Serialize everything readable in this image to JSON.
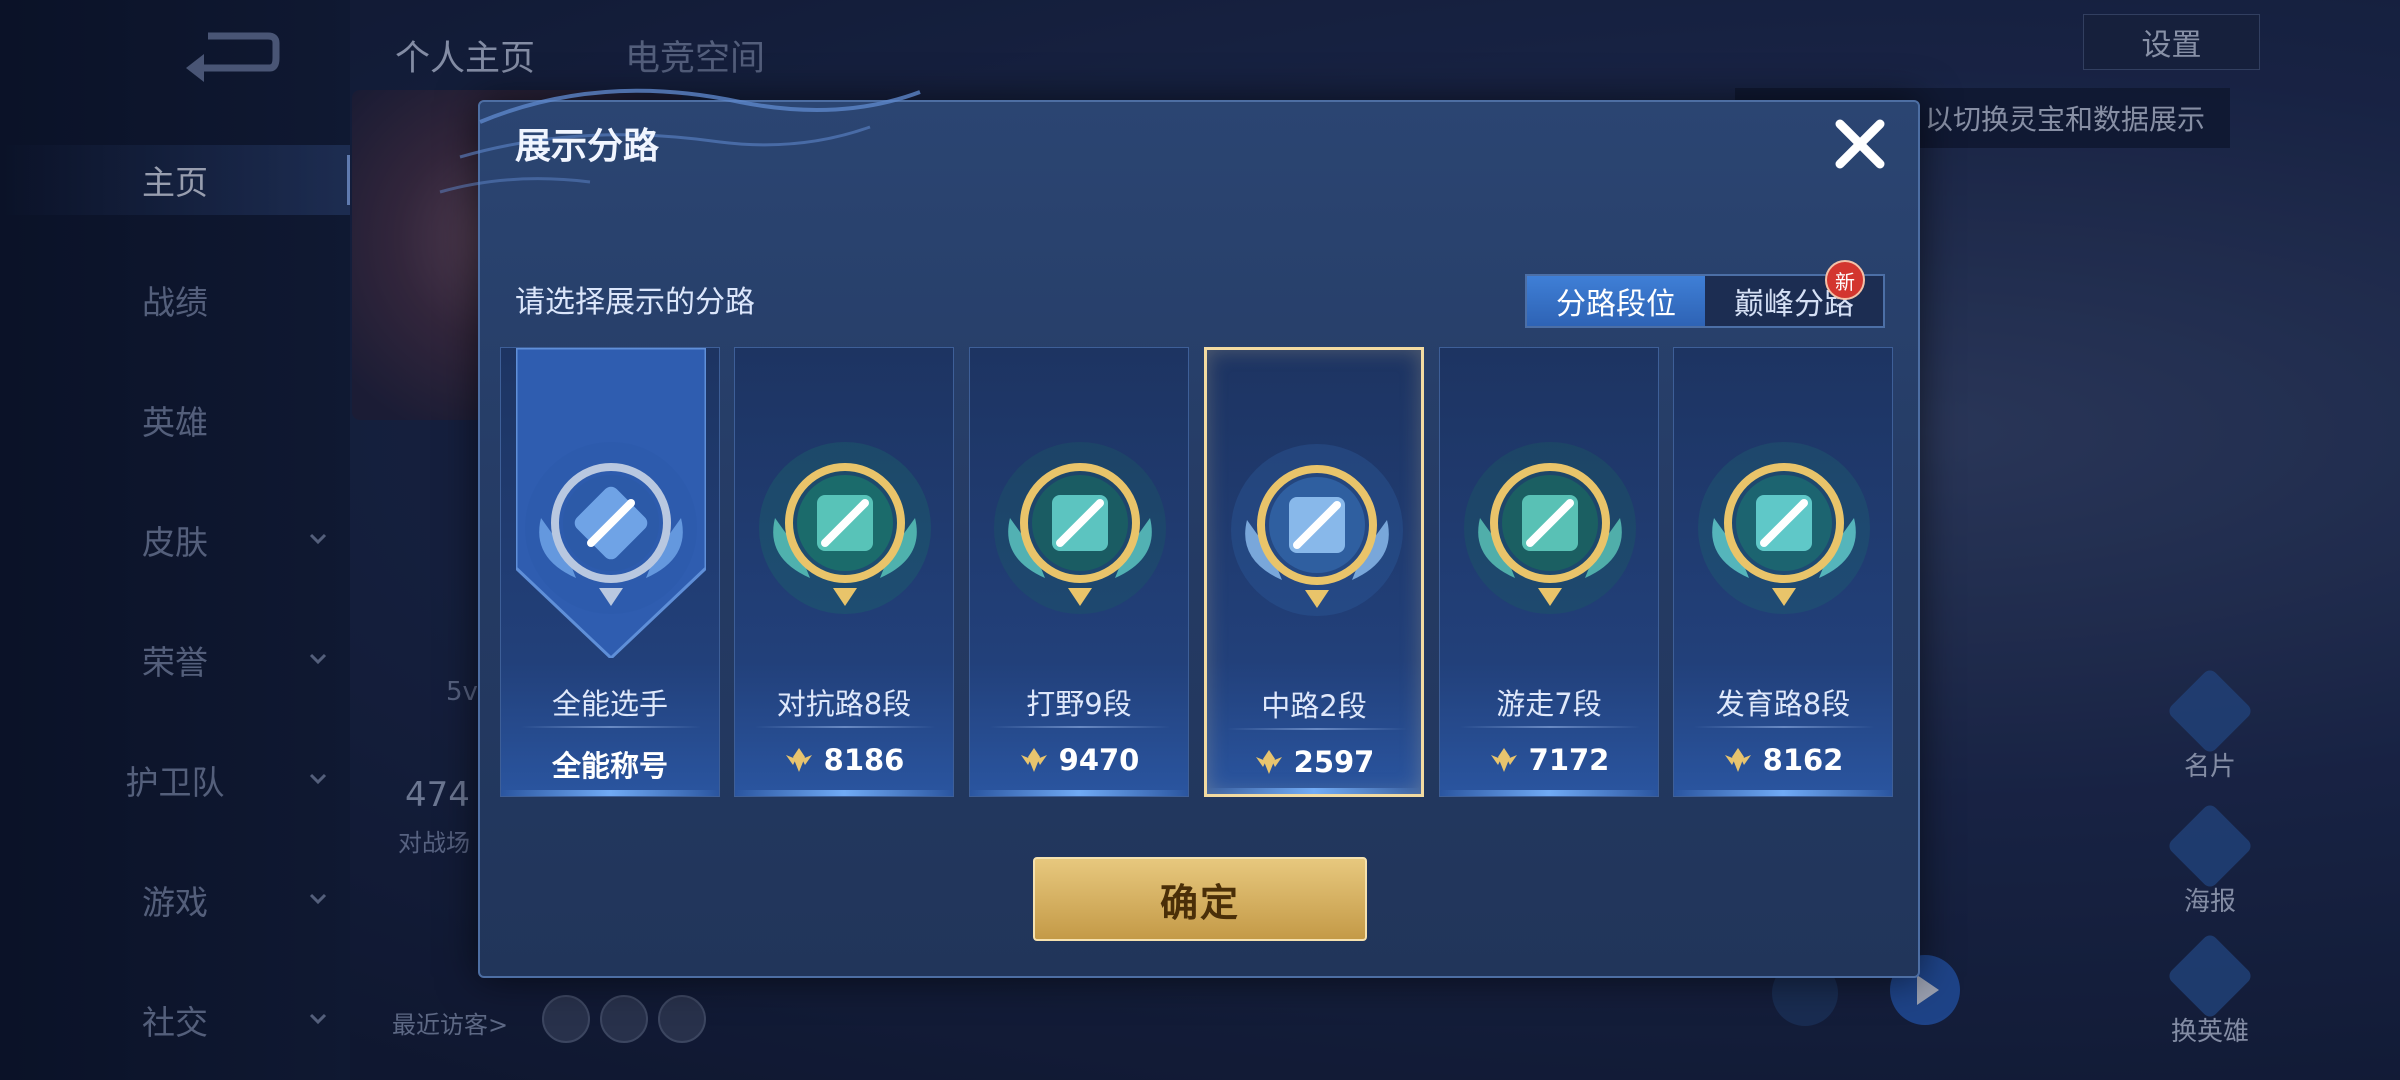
{
  "nav": {
    "items": [
      {
        "label": "主页",
        "active": true,
        "expandable": false
      },
      {
        "label": "战绩",
        "active": false,
        "expandable": false
      },
      {
        "label": "英雄",
        "active": false,
        "expandable": false
      },
      {
        "label": "皮肤",
        "active": false,
        "expandable": true
      },
      {
        "label": "荣誉",
        "active": false,
        "expandable": true
      },
      {
        "label": "护卫队",
        "active": false,
        "expandable": true
      },
      {
        "label": "游戏",
        "active": false,
        "expandable": true
      },
      {
        "label": "社交",
        "active": false,
        "expandable": true
      }
    ]
  },
  "background": {
    "tabs": [
      "个人主页",
      "电竞空间"
    ],
    "settings_label": "设置",
    "hint": "以切换灵宝和数据展示",
    "stat_value": "474",
    "stat_label": "对战场",
    "mode_label": "5v",
    "visitors_label": "最近访客>",
    "side_buttons": [
      "名片",
      "海报",
      "换英雄"
    ]
  },
  "modal": {
    "title": "展示分路",
    "subtitle": "请选择展示的分路",
    "toggle": {
      "options": [
        "分路段位",
        "巅峰分路"
      ],
      "active_index": 0
    },
    "new_badge": "新",
    "cards": [
      {
        "name": "全能选手",
        "score": "全能称号",
        "has_points_icon": false,
        "selected": false,
        "icon": "all-round-emblem-icon"
      },
      {
        "name": "对抗路8段",
        "score": "8186",
        "has_points_icon": true,
        "selected": false,
        "icon": "clash-lane-emblem-icon"
      },
      {
        "name": "打野9段",
        "score": "9470",
        "has_points_icon": true,
        "selected": false,
        "icon": "jungle-dragon-emblem-icon"
      },
      {
        "name": "中路2段",
        "score": "2597",
        "has_points_icon": true,
        "selected": true,
        "icon": "mid-lane-emblem-icon"
      },
      {
        "name": "游走7段",
        "score": "7172",
        "has_points_icon": true,
        "selected": false,
        "icon": "roam-emblem-icon"
      },
      {
        "name": "发育路8段",
        "score": "8162",
        "has_points_icon": true,
        "selected": false,
        "icon": "farm-lane-emblem-icon"
      }
    ],
    "confirm_label": "确定"
  },
  "colors": {
    "modal_bg": "#243a63",
    "accent_blue": "#2e63b5",
    "selected_border": "#f3dba1",
    "gold_button": "#d4b062",
    "badge_red": "#d3362f"
  }
}
